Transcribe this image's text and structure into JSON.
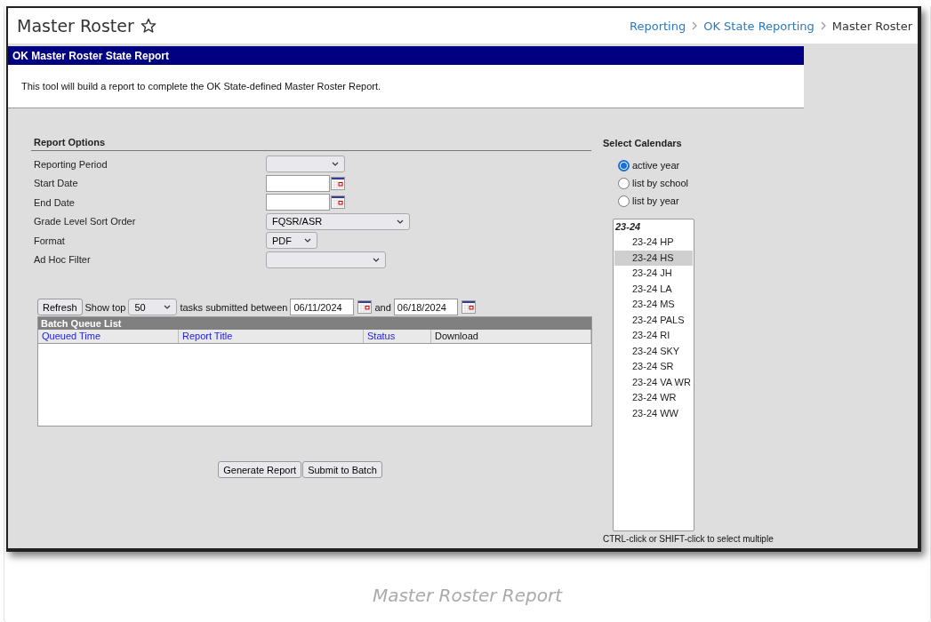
{
  "header": {
    "title": "Master Roster"
  },
  "breadcrumbs": [
    {
      "label": "Reporting",
      "kind": "link"
    },
    {
      "label": "OK State Reporting",
      "kind": "link"
    },
    {
      "label": "Master Roster",
      "kind": "current"
    }
  ],
  "panel": {
    "title": "OK Master Roster State Report",
    "description": "This tool will build a report to complete the OK State-defined Master Roster Report."
  },
  "report_options": {
    "title": "Report Options",
    "fields": [
      {
        "label": "Reporting Period",
        "kind": "select"
      },
      {
        "label": "Start Date",
        "kind": "date"
      },
      {
        "label": "End Date",
        "kind": "date"
      },
      {
        "label": "Grade Level Sort Order",
        "kind": "select",
        "value": "FQSR/ASR"
      },
      {
        "label": "Format",
        "kind": "select",
        "value": "PDF"
      },
      {
        "label": "Ad Hoc Filter",
        "kind": "select"
      }
    ]
  },
  "batch": {
    "refresh": "Refresh",
    "show_top": "Show top",
    "top_value": "50",
    "between": "tasks submitted between",
    "start_date": "06/11/2024",
    "and": "and",
    "end_date": "06/18/2024",
    "title": "Batch Queue List",
    "columns": [
      {
        "label": "Queued Time",
        "kind": "link"
      },
      {
        "label": "Report Title",
        "kind": "link"
      },
      {
        "label": "Status",
        "kind": "link"
      },
      {
        "label": "Download",
        "kind": "plain"
      }
    ]
  },
  "buttons": [
    "Generate Report",
    "Submit to Batch"
  ],
  "calendars": {
    "title": "Select Calendars",
    "options": [
      {
        "label": "active year",
        "selected": true
      },
      {
        "label": "list by school",
        "selected": false
      },
      {
        "label": "list by year",
        "selected": false
      }
    ],
    "group": "23-24",
    "items": [
      {
        "label": "23-24 HP",
        "selected": false
      },
      {
        "label": "23-24 HS",
        "selected": true
      },
      {
        "label": "23-24 JH",
        "selected": false
      },
      {
        "label": "23-24 LA",
        "selected": false
      },
      {
        "label": "23-24 MS",
        "selected": false
      },
      {
        "label": "23-24 PALS",
        "selected": false
      },
      {
        "label": "23-24 RI",
        "selected": false
      },
      {
        "label": "23-24 SKY",
        "selected": false
      },
      {
        "label": "23-24 SR",
        "selected": false
      },
      {
        "label": "23-24 VA WR",
        "selected": false
      },
      {
        "label": "23-24 WR",
        "selected": false
      },
      {
        "label": "23-24 WW",
        "selected": false
      }
    ],
    "hint": "CTRL-click or SHIFT-click to select multiple"
  },
  "caption": "Master Roster Report"
}
